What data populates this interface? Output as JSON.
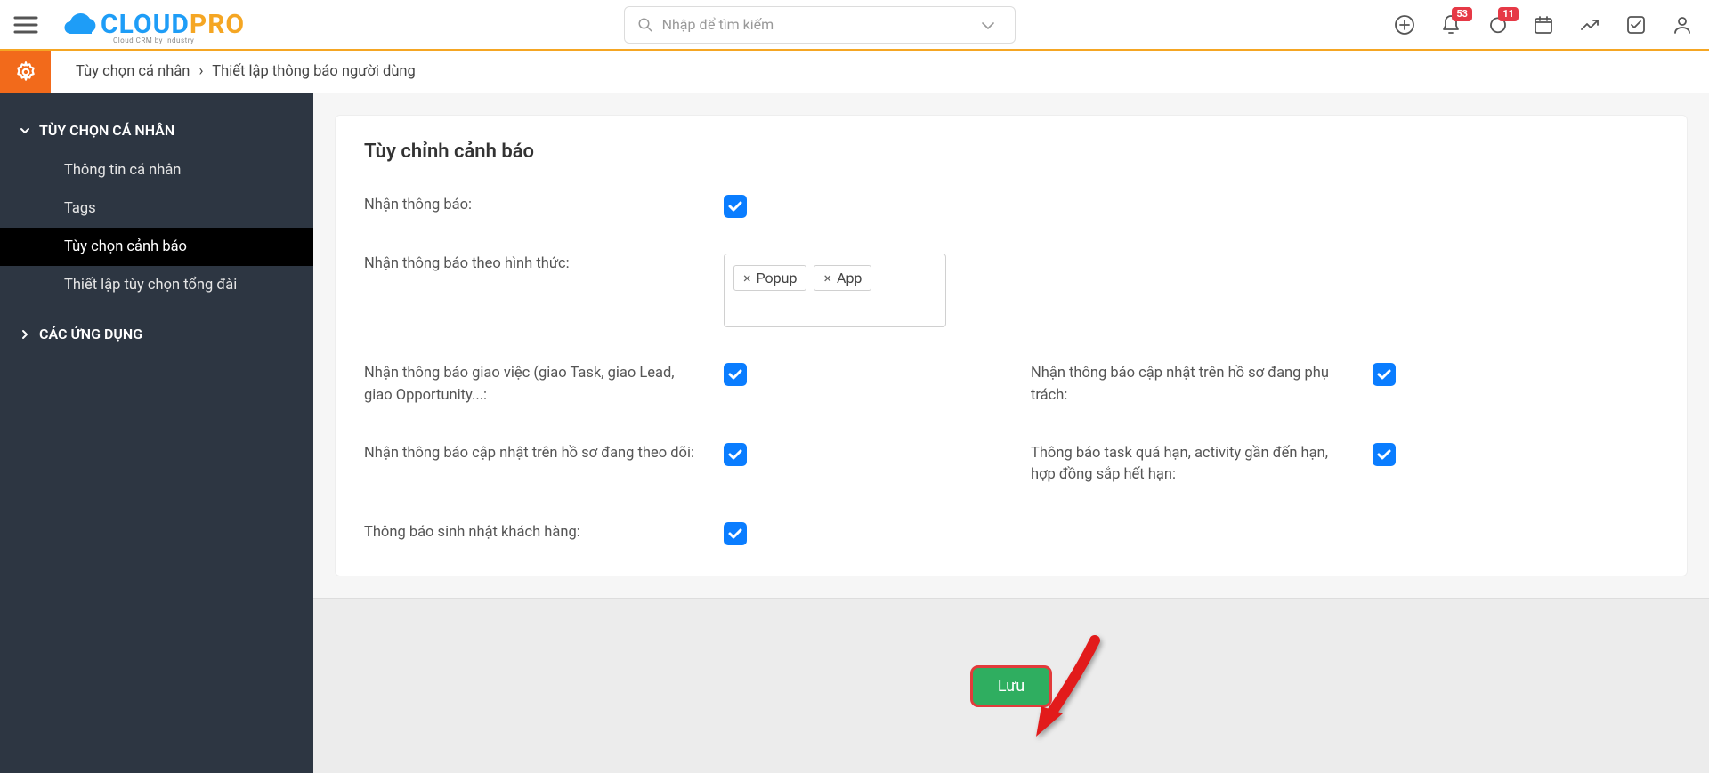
{
  "header": {
    "search_placeholder": "Nhập để tìm kiếm",
    "logo_main_blue": "CLOUD",
    "logo_main_orange": "PRO",
    "logo_sub": "Cloud CRM by Industry",
    "notif_badge": "53",
    "chat_badge": "11"
  },
  "breadcrumb": {
    "a": "Tùy chọn cá nhân",
    "b": "Thiết lập thông báo người dùng"
  },
  "sidebar": {
    "group1": "TÙY CHỌN CÁ NHÂN",
    "items1": [
      "Thông tin cá nhân",
      "Tags",
      "Tùy chọn cảnh báo",
      "Thiết lập tùy chọn tổng đài"
    ],
    "group2": "CÁC ỨNG DỤNG"
  },
  "panel": {
    "title": "Tùy chỉnh cảnh báo",
    "f1": "Nhận thông báo:",
    "f2": "Nhận thông báo theo hình thức:",
    "tag1": "Popup",
    "tag2": "App",
    "f3": "Nhận thông báo giao việc (giao Task, giao Lead, giao Opportunity...:",
    "f4": "Nhận thông báo cập nhật trên hồ sơ đang phụ trách:",
    "f5": "Nhận thông báo cập nhật trên hồ sơ đang theo dõi:",
    "f6": "Thông báo task quá hạn, activity gần đến hạn, hợp đồng sắp hết hạn:",
    "f7": "Thông báo sinh nhật khách hàng:",
    "save": "Lưu"
  }
}
